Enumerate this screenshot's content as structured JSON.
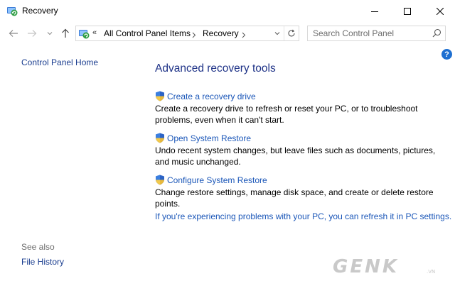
{
  "window": {
    "title": "Recovery"
  },
  "nav": {
    "breadcrumb_overflow": "«",
    "crumbs": [
      "All Control Panel Items",
      "Recovery"
    ]
  },
  "search": {
    "placeholder": "Search Control Panel"
  },
  "help": {
    "glyph": "?"
  },
  "sidebar": {
    "home_label": "Control Panel Home",
    "see_also_label": "See also",
    "see_also_items": [
      "File History"
    ]
  },
  "main": {
    "title": "Advanced recovery tools",
    "tasks": [
      {
        "label": "Create a recovery drive",
        "description": "Create a recovery drive to refresh or reset your PC, or to troubleshoot problems, even when it can't start."
      },
      {
        "label": "Open System Restore",
        "description": "Undo recent system changes, but leave files such as documents, pictures, and music unchanged."
      },
      {
        "label": "Configure System Restore",
        "description": "Change restore settings, manage disk space, and create or delete restore points."
      }
    ],
    "refresh_link": "If you're experiencing problems with your PC, you can refresh it in PC settings."
  },
  "watermark": {
    "brand": "GENK",
    "suffix": ".VN"
  },
  "colors": {
    "link": "#1a56b8",
    "title": "#1e3287",
    "sidebar_link": "#1a3d8f",
    "help_badge": "#1e6fd1",
    "watermark": "#c9c9c9"
  }
}
